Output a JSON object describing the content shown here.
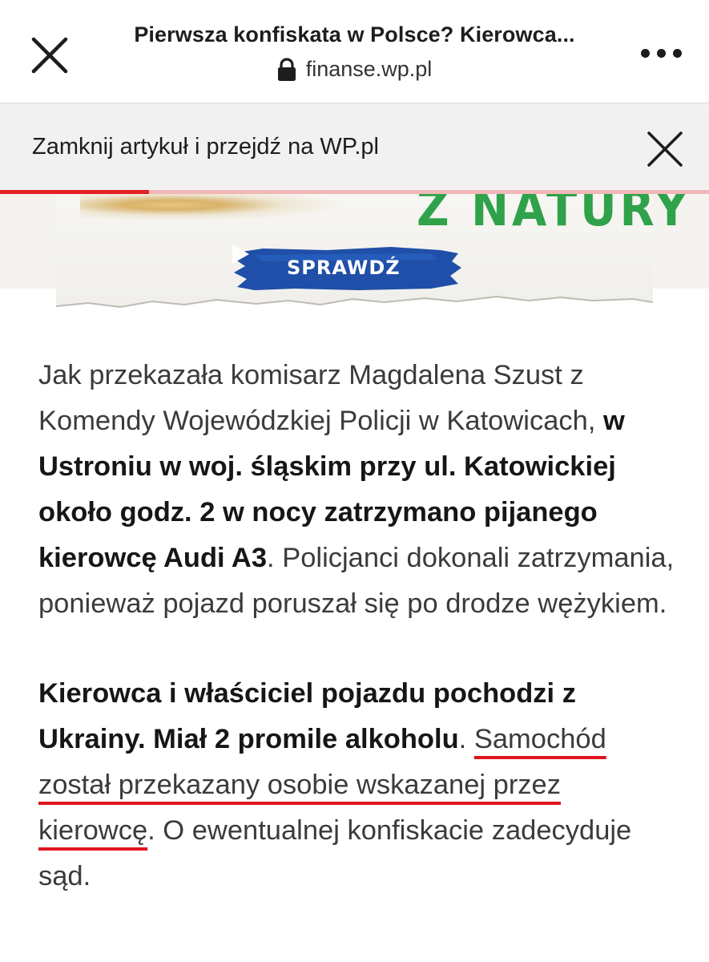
{
  "browser": {
    "title": "Pierwsza konfiskata w Polsce? Kierowca...",
    "domain": "finanse.wp.pl",
    "close_icon": "close-icon",
    "lock_icon": "lock-icon",
    "more_icon": "more-vert-dots-icon"
  },
  "article_bar": {
    "label": "Zamknij artykuł i przejdź na WP.pl",
    "close_icon": "close-icon",
    "reading_progress": 0.21
  },
  "ad": {
    "brand_fragment": "Z NATURY",
    "cta_label": "SPRAWDŹ",
    "cta_icon": "play-arrow-icon"
  },
  "article": {
    "p1_seg1": "Jak przekazała komisarz Magdalena Szust z Komendy Wojewódzkiej Policji w Katowicach, ",
    "p1_seg2_bold": "w Ustroniu w woj. śląskim przy ul. Katowickiej około godz. 2 w nocy zatrzymano pijanego kierowcę Audi A3",
    "p1_seg3": ". Policjanci dokonali zatrzymania, ponieważ pojazd poruszał się po drodze wężykiem.",
    "p2_seg1_bold": "Kierowca i właściciel pojazdu pochodzi z Ukrainy. Miał 2 promile alkoholu",
    "p2_seg2": ". ",
    "p2_seg3_underlined": "Samochód został przekazany osobie wskazanej przez kierowcę",
    "p2_seg4": ". O ewentualnej konfiskacie zadecyduje sąd."
  },
  "colors": {
    "accent_red": "#e32024",
    "ad_green": "#2fa24a",
    "ad_blue": "#1f4fa8"
  }
}
